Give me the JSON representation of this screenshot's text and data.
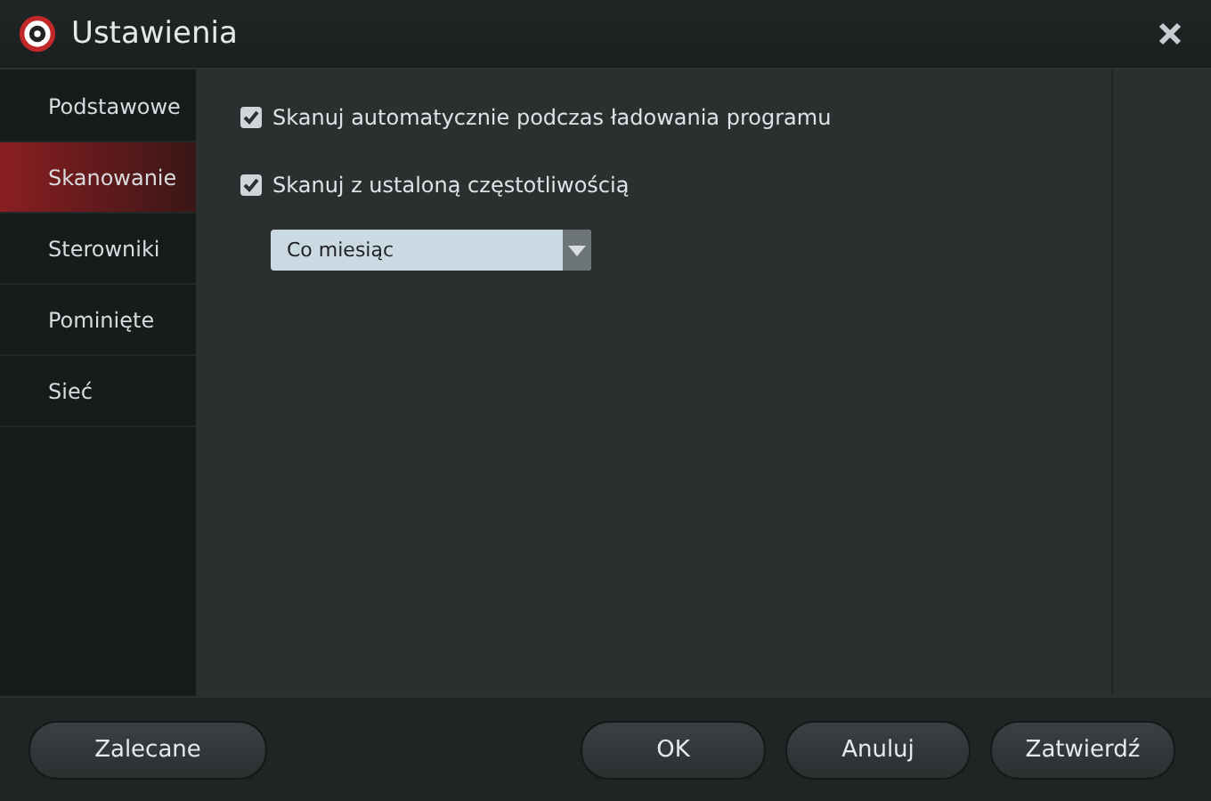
{
  "window": {
    "title": "Ustawienia"
  },
  "sidebar": {
    "items": [
      {
        "label": "Podstawowe",
        "selected": false
      },
      {
        "label": "Skanowanie",
        "selected": true
      },
      {
        "label": "Sterowniki",
        "selected": false
      },
      {
        "label": "Pominięte",
        "selected": false
      },
      {
        "label": "Sieć",
        "selected": false
      }
    ]
  },
  "options": [
    {
      "label": "Skanuj automatycznie podczas ładowania programu",
      "checked": true
    },
    {
      "label": "Skanuj z ustaloną częstotliwością",
      "checked": true
    }
  ],
  "frequency_dropdown": {
    "value": "Co miesiąc"
  },
  "buttons": {
    "left": [
      "Zalecane"
    ],
    "right": [
      "OK",
      "Anuluj",
      "Zatwierdź"
    ]
  }
}
